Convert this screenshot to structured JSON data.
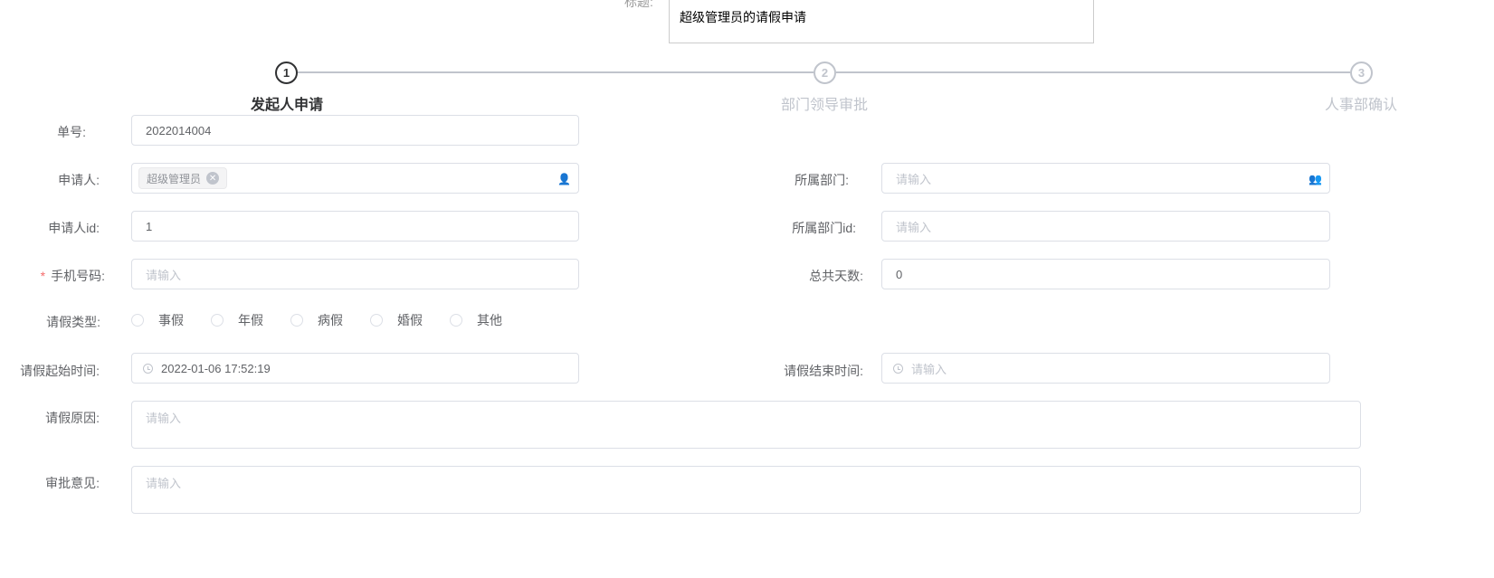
{
  "header": {
    "title_label": "标题:",
    "title_value": "超级管理员的请假申请"
  },
  "steps": [
    {
      "num": "1",
      "title": "发起人申请",
      "active": true
    },
    {
      "num": "2",
      "title": "部门领导审批",
      "active": false
    },
    {
      "num": "3",
      "title": "人事部确认",
      "active": false
    }
  ],
  "form": {
    "order_no": {
      "label": "单号:",
      "value": "2022014004"
    },
    "applicant": {
      "label": "申请人:",
      "tag": "超级管理员",
      "icon": "user-icon"
    },
    "department": {
      "label": "所属部门:",
      "placeholder": "请输入",
      "icon": "users-icon"
    },
    "applicant_id": {
      "label": "申请人id:",
      "value": "1"
    },
    "department_id": {
      "label": "所属部门id:",
      "placeholder": "请输入"
    },
    "phone": {
      "label": "手机号码:",
      "required_mark": "*",
      "placeholder": "请输入"
    },
    "total_days": {
      "label": "总共天数:",
      "value": "0"
    },
    "leave_type": {
      "label": "请假类型:",
      "options": [
        "事假",
        "年假",
        "病假",
        "婚假",
        "其他"
      ]
    },
    "start_time": {
      "label": "请假起始时间:",
      "value": "2022-01-06 17:52:19",
      "icon": "clock-icon"
    },
    "end_time": {
      "label": "请假结束时间:",
      "placeholder": "请输入",
      "icon": "clock-icon"
    },
    "reason": {
      "label": "请假原因:",
      "placeholder": "请输入"
    },
    "opinion": {
      "label": "审批意见:",
      "placeholder": "请输入"
    }
  }
}
